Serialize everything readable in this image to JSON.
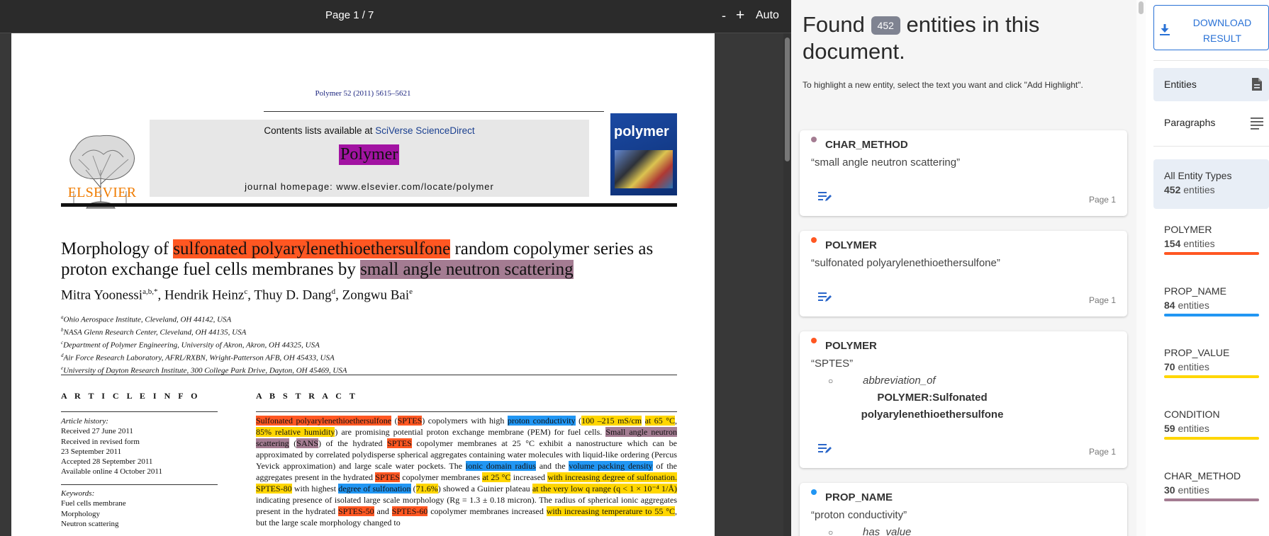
{
  "viewer": {
    "page_indicator": "Page 1 / 7",
    "zoom_out": "-",
    "zoom_in": "+",
    "zoom_level": "Auto"
  },
  "paper": {
    "journal_ref": "Polymer 52 (2011) 5615–5621",
    "contents_prefix": "Contents lists available at ",
    "contents_link": "SciVerse ScienceDirect",
    "journal_name": "Polymer",
    "homepage": "journal homepage: www.elsevier.com/locate/polymer",
    "publisher": "ELSEVIER",
    "cover_title": "polymer",
    "title": {
      "prefix": "Morphology of ",
      "entity_polymer": "sulfonated polyarylenethioethersulfone",
      "middle": " random copolymer series as proton exchange fuel cells membranes by ",
      "entity_method": "small angle neutron scattering"
    },
    "authors": [
      {
        "name": "Mitra Yoonessi",
        "sup": "a,b,*"
      },
      {
        "name": "Hendrik Heinz",
        "sup": "c"
      },
      {
        "name": "Thuy D. Dang",
        "sup": "d"
      },
      {
        "name": "Zongwu Bai",
        "sup": "e"
      }
    ],
    "affiliations": [
      {
        "sup": "a",
        "text": "Ohio Aerospace Institute, Cleveland, OH 44142, USA"
      },
      {
        "sup": "b",
        "text": "NASA Glenn Research Center, Cleveland, OH 44135, USA"
      },
      {
        "sup": "c",
        "text": "Department of Polymer Engineering, University of Akron, Akron, OH 44325, USA"
      },
      {
        "sup": "d",
        "text": "Air Force Research Laboratory, AFRL/RXBN, Wright-Patterson AFB, OH 45433, USA"
      },
      {
        "sup": "e",
        "text": "University of Dayton Research Institute, 300 College Park Drive, Dayton, OH 45469, USA"
      }
    ],
    "article_info_title": "A R T I C L E   I N F O",
    "article_history_label": "Article history:",
    "article_history": [
      "Received 27 June 2011",
      "Received in revised form",
      "23 September 2011",
      "Accepted 28 September 2011",
      "Available online 4 October 2011"
    ],
    "keywords_label": "Keywords:",
    "keywords": [
      "Fuel cells membrane",
      "Morphology",
      "Neutron scattering"
    ],
    "abstract_title": "A B S T R A C T",
    "abstract_segments": [
      {
        "t": "Sulfonated polyarylenethioethersulfone",
        "hl": "polymer"
      },
      {
        "t": " (",
        "hl": ""
      },
      {
        "t": "SPTES",
        "hl": "polymer"
      },
      {
        "t": ") copolymers with high ",
        "hl": ""
      },
      {
        "t": "proton conductivity",
        "hl": "blue"
      },
      {
        "t": " (",
        "hl": ""
      },
      {
        "t": "100 –215 mS/cm",
        "hl": "yellow"
      },
      {
        "t": " ",
        "hl": ""
      },
      {
        "t": "at 65 °C",
        "hl": "yellow"
      },
      {
        "t": ", ",
        "hl": ""
      },
      {
        "t": "85% relative humidity",
        "hl": "yellow"
      },
      {
        "t": ") are promising potential proton exchange membrane (PEM) for fuel cells. ",
        "hl": ""
      },
      {
        "t": "Small angle neutron scattering",
        "hl": "method"
      },
      {
        "t": " (",
        "hl": ""
      },
      {
        "t": "SANS",
        "hl": "method"
      },
      {
        "t": ") of the hydrated ",
        "hl": ""
      },
      {
        "t": "SPTES",
        "hl": "polymer"
      },
      {
        "t": " copolymer membranes at 25 °C exhibit a nanostructure which can be approximated by correlated polydisperse spherical aggregates containing water molecules with liquid-like ordering (Percus Yevick approximation) and large scale water pockets. The ",
        "hl": ""
      },
      {
        "t": "ionic domain radius",
        "hl": "blue"
      },
      {
        "t": " and the ",
        "hl": ""
      },
      {
        "t": "volume packing density",
        "hl": "blue"
      },
      {
        "t": " of the aggregates present in the hydrated ",
        "hl": ""
      },
      {
        "t": "SPTES",
        "hl": "polymer"
      },
      {
        "t": " copolymer membranes ",
        "hl": ""
      },
      {
        "t": "at 25 °C",
        "hl": "yellow"
      },
      {
        "t": " increased ",
        "hl": ""
      },
      {
        "t": "with increasing degree of sulfonation.",
        "hl": "yellow"
      },
      {
        "t": " ",
        "hl": ""
      },
      {
        "t": "SPTES-80",
        "hl": "yellow"
      },
      {
        "t": " with highest ",
        "hl": ""
      },
      {
        "t": "degree of sulfonation",
        "hl": "blue"
      },
      {
        "t": " (",
        "hl": ""
      },
      {
        "t": "71.6%",
        "hl": "yellow"
      },
      {
        "t": ") showed a Guinier plateau ",
        "hl": ""
      },
      {
        "t": "at the very low q range (q < 1 × 10⁻⁴ 1/Å)",
        "hl": "yellow"
      },
      {
        "t": " indicating presence of isolated large scale morphology (Rg = 1.3 ± 0.18 micron). The radius of spherical ionic aggregates present in the hydrated ",
        "hl": ""
      },
      {
        "t": "SPTES-50",
        "hl": "polymer"
      },
      {
        "t": " and ",
        "hl": ""
      },
      {
        "t": "SPTES-60",
        "hl": "polymer"
      },
      {
        "t": " copolymer membranes increased ",
        "hl": ""
      },
      {
        "t": "with increasing temperature to 55 °C",
        "hl": "yellow"
      },
      {
        "t": ", but the large scale morphology changed to",
        "hl": ""
      }
    ]
  },
  "entities_panel": {
    "found_prefix": "Found",
    "found_count": "452",
    "found_suffix": "entities in this document.",
    "hint": "To highlight a new entity, select the text you want and click \"Add Highlight\".",
    "cards": [
      {
        "type": "CHAR_METHOD",
        "dot_color": "#a47c92",
        "quote": "“small angle neutron scattering”",
        "page": "Page 1"
      },
      {
        "type": "POLYMER",
        "dot_color": "#ff5722",
        "quote": "“sulfonated polyarylenethioethersulfone”",
        "page": "Page 1"
      },
      {
        "type": "POLYMER",
        "dot_color": "#ff5722",
        "quote": "“SPTES”",
        "relation_type": "abbreviation_of",
        "relation_target": "POLYMER:Sulfonated polyarylenethioethersulfone",
        "page": "Page 1"
      },
      {
        "type": "PROP_NAME",
        "dot_color": "#2196f3",
        "quote": "“proton conductivity”",
        "relation_type": "has_value"
      }
    ]
  },
  "sidebar": {
    "download_label": "DOWNLOAD RESULT",
    "nav_entities": "Entities",
    "nav_paragraphs": "Paragraphs",
    "all_types": {
      "name": "All Entity Types",
      "count": "452",
      "unit": "entities"
    },
    "entity_types": [
      {
        "name": "POLYMER",
        "count": "154",
        "unit": "entities",
        "color": "#ff5722"
      },
      {
        "name": "PROP_NAME",
        "count": "84",
        "unit": "entities",
        "color": "#2196f3"
      },
      {
        "name": "PROP_VALUE",
        "count": "70",
        "unit": "entities",
        "color": "#ffd600"
      },
      {
        "name": "CONDITION",
        "count": "59",
        "unit": "entities",
        "color": "#ffd600"
      },
      {
        "name": "CHAR_METHOD",
        "count": "30",
        "unit": "entities",
        "color": "#a47c92"
      }
    ]
  }
}
